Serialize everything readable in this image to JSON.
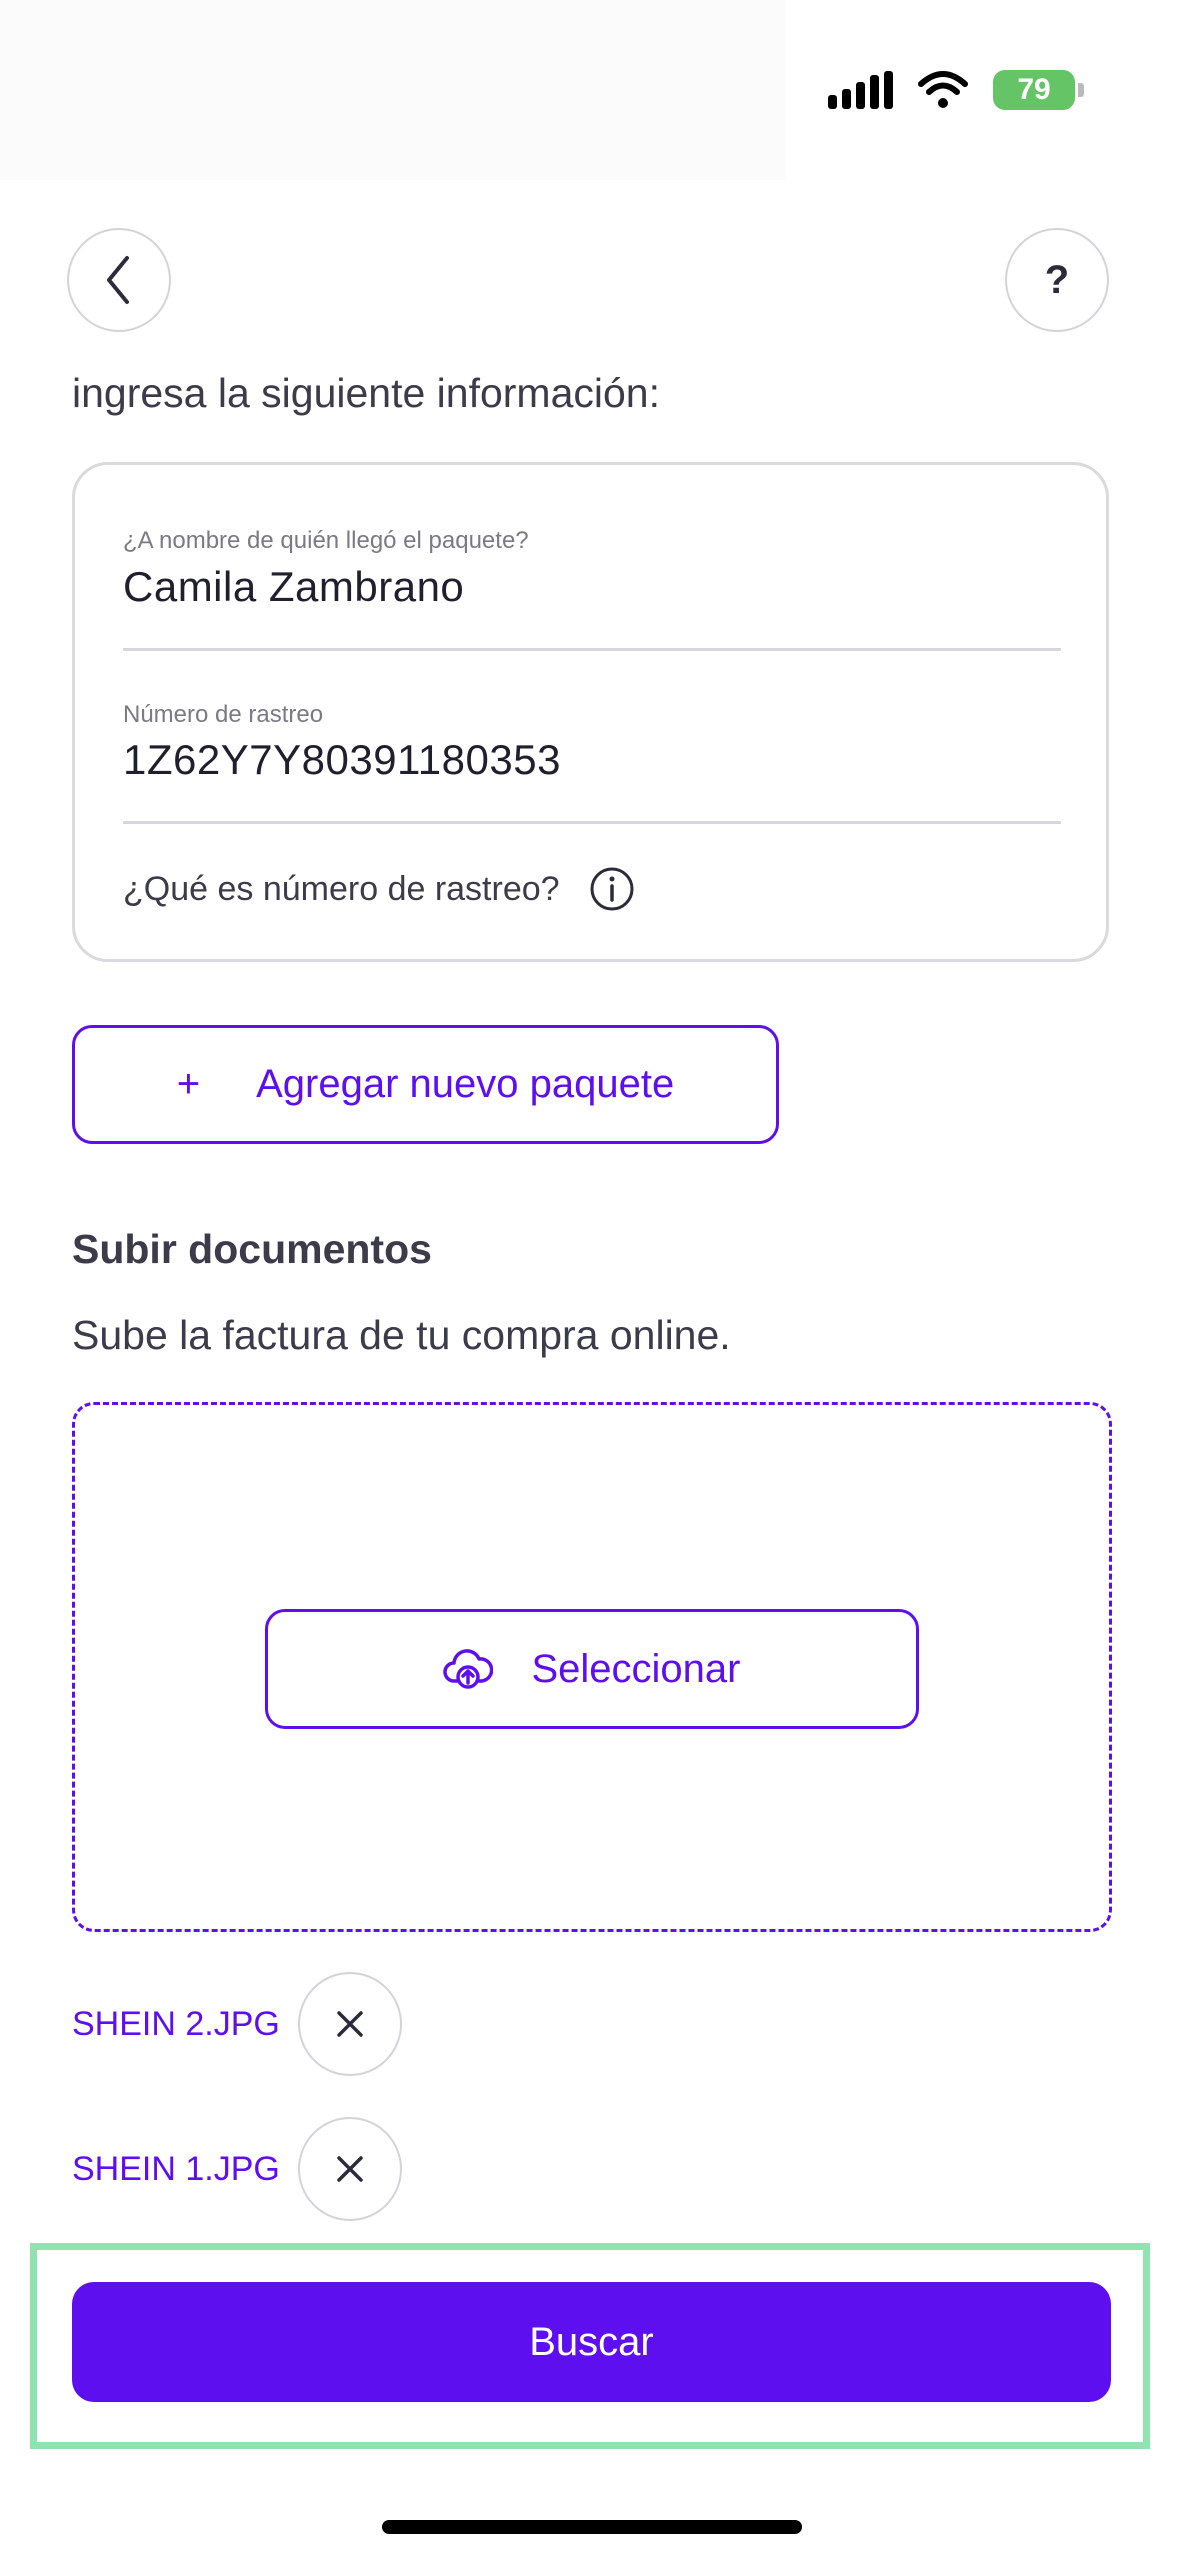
{
  "status_bar": {
    "battery_level": "79"
  },
  "header": {
    "help_label": "?"
  },
  "intro_text": "ingresa la siguiente información:",
  "form": {
    "recipient_label": "¿A nombre de quién llegó el paquete?",
    "recipient_value": "Camila Zambrano",
    "tracking_label": "Número de rastreo",
    "tracking_value": "1Z62Y7Y80391180353",
    "tracking_help": "¿Qué es número de rastreo?"
  },
  "add_package": {
    "plus": "+",
    "label": "Agregar nuevo paquete"
  },
  "documents": {
    "title": "Subir documentos",
    "subtitle": "Sube la factura de tu compra online.",
    "select_label": "Seleccionar",
    "files": [
      {
        "name": "SHEIN 2.JPG"
      },
      {
        "name": "SHEIN 1.JPG"
      }
    ]
  },
  "search_button": "Buscar",
  "colors": {
    "accent": "#5e0ff0",
    "highlight": "#8fe3b0",
    "battery": "#65c466"
  }
}
